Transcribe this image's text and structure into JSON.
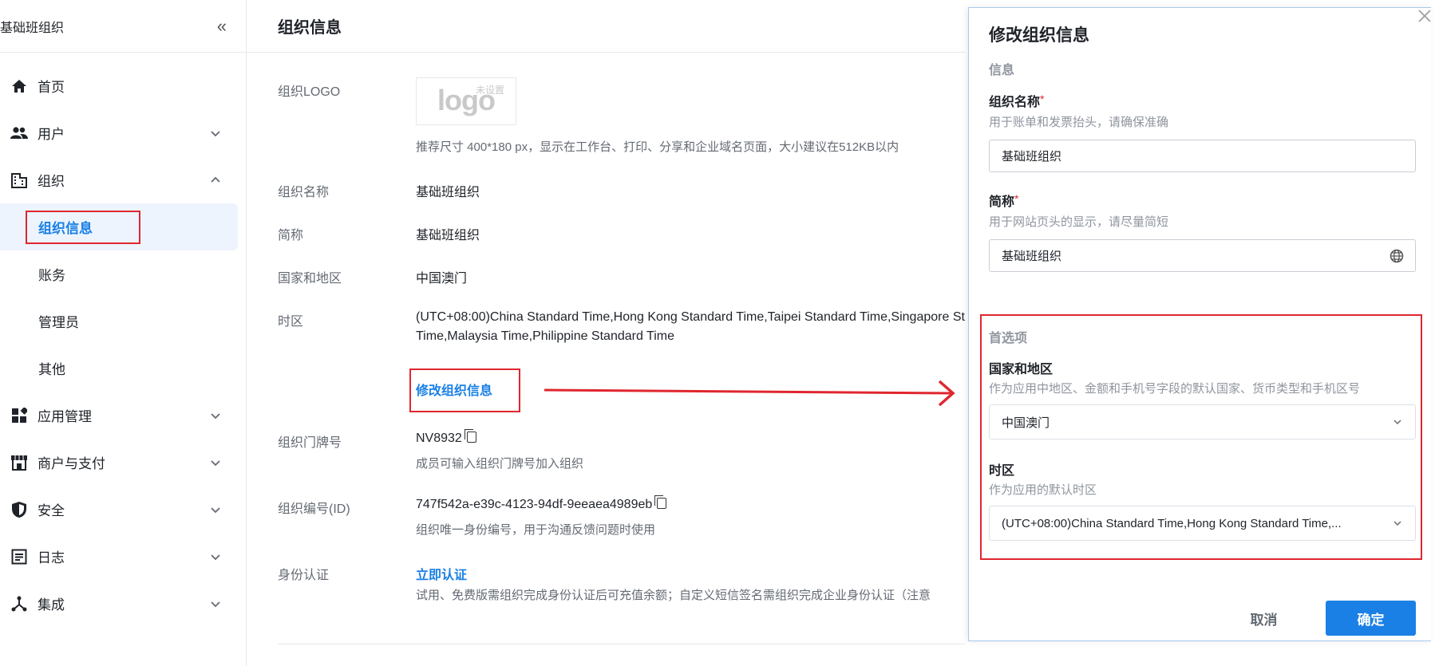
{
  "sidebar": {
    "title": "基础班组织",
    "collapse_icon": "«",
    "items": [
      {
        "label": "首页",
        "icon": "home-icon",
        "chevron": "none"
      },
      {
        "label": "用户",
        "icon": "users-icon",
        "chevron": "down"
      },
      {
        "label": "组织",
        "icon": "building-icon",
        "chevron": "up"
      },
      {
        "label": "应用管理",
        "icon": "apps-icon",
        "chevron": "down"
      },
      {
        "label": "商户与支付",
        "icon": "shop-icon",
        "chevron": "down"
      },
      {
        "label": "安全",
        "icon": "shield-icon",
        "chevron": "down"
      },
      {
        "label": "日志",
        "icon": "log-icon",
        "chevron": "down"
      },
      {
        "label": "集成",
        "icon": "integration-icon",
        "chevron": "down"
      }
    ],
    "org_sub": [
      "组织信息",
      "账务",
      "管理员",
      "其他"
    ],
    "active_sub": "组织信息"
  },
  "main": {
    "title": "组织信息",
    "logo_label": "组织LOGO",
    "logo_text": "logo",
    "logo_tag": "未设置",
    "logo_hint": "推荐尺寸 400*180 px，显示在工作台、打印、分享和企业域名页面，大小建议在512KB以内",
    "name_label": "组织名称",
    "name_value": "基础班组织",
    "short_label": "简称",
    "short_value": "基础班组织",
    "country_label": "国家和地区",
    "country_value": "中国澳门",
    "tz_label": "时区",
    "tz_line1": "(UTC+08:00)China Standard Time,Hong Kong Standard Time,Taipei Standard Time,Singapore St",
    "tz_line2": "Time,Malaysia Time,Philippine Standard Time",
    "edit_link": "修改组织信息",
    "door_label": "组织门牌号",
    "door_value": "NV8932",
    "door_hint": "成员可输入组织门牌号加入组织",
    "id_label": "组织编号(ID)",
    "id_value": "747f542a-e39c-4123-94df-9eeaea4989eb",
    "id_hint": "组织唯一身份编号，用于沟通反馈问题时使用",
    "auth_label": "身份认证",
    "auth_link": "立即认证",
    "auth_hint": "试用、免费版需组织完成身份认证后可充值余额；自定义短信签名需组织完成企业身份认证（注意"
  },
  "drawer": {
    "title": "修改组织信息",
    "section_info": "信息",
    "name_label": "组织名称",
    "name_desc": "用于账单和发票抬头，请确保准确",
    "name_value": "基础班组织",
    "short_label": "简称",
    "short_desc": "用于网站页头的显示，请尽量简短",
    "short_value": "基础班组织",
    "section_pref": "首选项",
    "country_label": "国家和地区",
    "country_desc": "作为应用中地区、金额和手机号字段的默认国家、货币类型和手机区号",
    "country_value": "中国澳门",
    "tz_label": "时区",
    "tz_desc": "作为应用的默认时区",
    "tz_value": "(UTC+08:00)China Standard Time,Hong Kong Standard Time,...",
    "required_mark": "*",
    "cancel": "取消",
    "confirm": "确定"
  },
  "colors": {
    "accent": "#1a80e6",
    "annotation": "#e0262f",
    "active_bg": "#edf4fd"
  }
}
